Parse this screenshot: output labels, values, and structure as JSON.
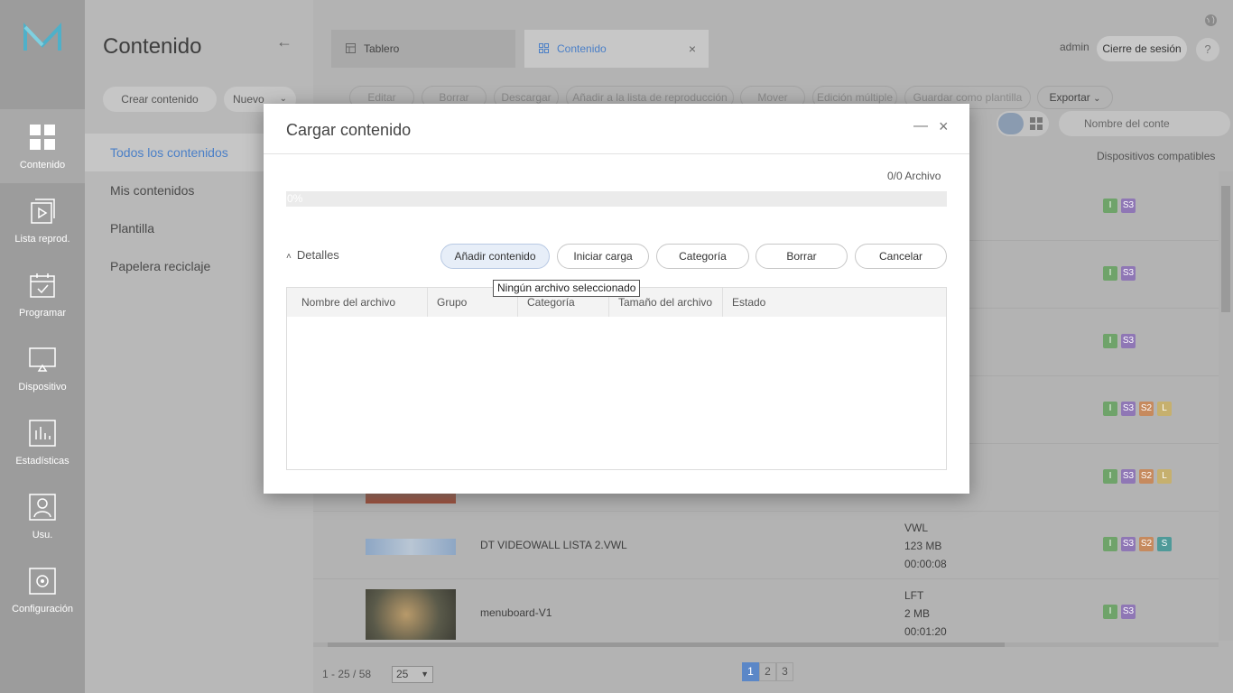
{
  "rail": {
    "items": [
      {
        "label": "Contenido"
      },
      {
        "label": "Lista reprod."
      },
      {
        "label": "Programar"
      },
      {
        "label": "Dispositivo"
      },
      {
        "label": "Estadísticas"
      },
      {
        "label": "Usu."
      },
      {
        "label": "Configuración"
      }
    ]
  },
  "sidebar": {
    "title": "Contenido",
    "back_icon": "←",
    "create_label": "Crear contenido",
    "new_label": "Nuevo",
    "nav": [
      {
        "label": "Todos los contenidos"
      },
      {
        "label": "Mis contenidos"
      },
      {
        "label": "Plantilla"
      },
      {
        "label": "Papelera reciclaje"
      }
    ]
  },
  "header": {
    "tabs": [
      {
        "label": "Tablero"
      },
      {
        "label": "Contenido"
      }
    ],
    "tab_close": "×",
    "user": "admin",
    "logout_label": "Cierre de sesión",
    "help_label": "?"
  },
  "toolbar": {
    "buttons": [
      "Editar",
      "Borrar",
      "Descargar",
      "Añadir a la lista de reproducción",
      "Mover",
      "Edición múltiple",
      "Guardar como plantilla",
      "Exportar"
    ],
    "search_placeholder": "Nombre del conte"
  },
  "list": {
    "compat_header": "Dispositivos compatibles",
    "rows": [
      {
        "name": "",
        "meta": [
          "",
          "",
          ""
        ],
        "badges": [
          "I",
          "S3"
        ]
      },
      {
        "name": "",
        "meta": [
          "",
          "",
          ""
        ],
        "badges": [
          "I",
          "S3"
        ]
      },
      {
        "name": "",
        "meta": [
          "",
          "",
          ""
        ],
        "badges": [
          "I",
          "S3"
        ]
      },
      {
        "name": "",
        "meta": [
          "",
          "",
          ""
        ],
        "badges": [
          "I",
          "S3",
          "S2",
          "L"
        ]
      },
      {
        "name": "",
        "meta": [
          "",
          "",
          ""
        ],
        "badges": [
          "I",
          "S3",
          "S2",
          "L"
        ]
      },
      {
        "name": "DT VIDEOWALL LISTA 2.VWL",
        "meta": [
          "VWL",
          "123 MB",
          "00:00:08"
        ],
        "badges": [
          "I",
          "S3",
          "S2",
          "S"
        ]
      },
      {
        "name": "menuboard-V1",
        "meta": [
          "LFT",
          "2 MB",
          "00:01:20"
        ],
        "badges": [
          "I",
          "S3"
        ]
      }
    ]
  },
  "pager": {
    "info": "1 - 25 / 58",
    "per_page": "25",
    "pages": [
      "1",
      "2",
      "3"
    ],
    "current_page": "1"
  },
  "modal": {
    "title": "Cargar contenido",
    "minimize": "—",
    "close": "×",
    "file_count": "0/0 Archivo",
    "progress_text": "0%",
    "progress_percent": 0,
    "details_label": "Detalles",
    "buttons": {
      "add": "Añadir contenido",
      "start": "Iniciar carga",
      "category": "Categoría",
      "delete": "Borrar",
      "cancel": "Cancelar"
    },
    "tooltip": "Ningún archivo seleccionado",
    "columns": [
      "Nombre del archivo",
      "Grupo",
      "Categoría",
      "Tamaño del archivo",
      "Estado"
    ]
  }
}
